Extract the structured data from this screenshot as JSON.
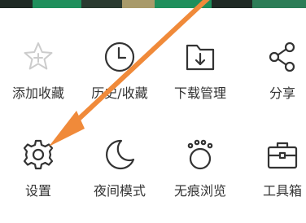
{
  "colors": {
    "icon_stroke": "#333333",
    "label_text": "#333333",
    "annotation_arrow": "#f08a3a",
    "strip_dark": "#1f2a25",
    "strip_green": "#1f8f5c",
    "strip_tan": "#a89a6a"
  },
  "menu": {
    "items": [
      {
        "label": "添加收藏",
        "icon": "star-plus-icon"
      },
      {
        "label": "历史/收藏",
        "icon": "clock-icon"
      },
      {
        "label": "下载管理",
        "icon": "download-folder-icon"
      },
      {
        "label": "分享",
        "icon": "share-icon"
      },
      {
        "label": "设置",
        "icon": "gear-icon"
      },
      {
        "label": "夜间模式",
        "icon": "moon-icon"
      },
      {
        "label": "无痕浏览",
        "icon": "paw-icon"
      },
      {
        "label": "工具箱",
        "icon": "toolbox-icon"
      }
    ]
  }
}
